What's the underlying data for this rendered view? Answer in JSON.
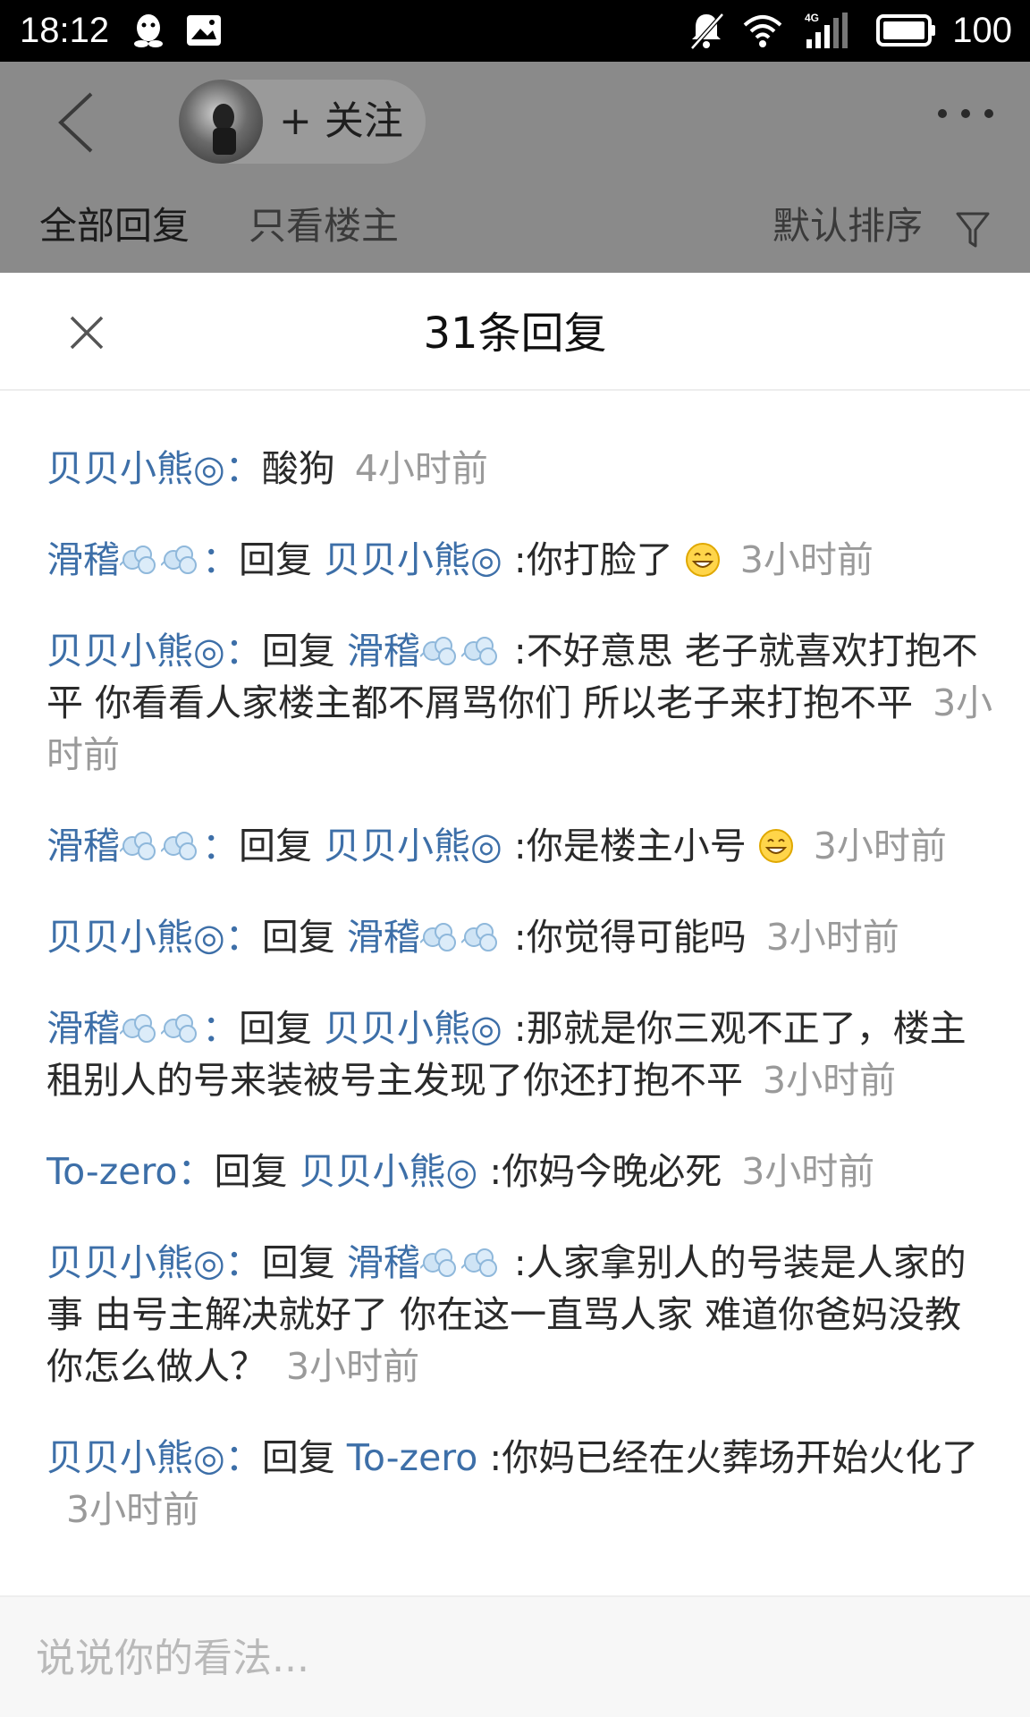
{
  "status_bar": {
    "time": "18:12",
    "battery": "100",
    "icons": [
      "qq-icon",
      "image-message-icon",
      "mute-icon",
      "wifi-icon",
      "signal-4g-icon",
      "battery-icon"
    ]
  },
  "header": {
    "follow_label": "+ 关注",
    "tabs": [
      {
        "label": "全部回复"
      },
      {
        "label": "只看楼主"
      }
    ],
    "sort_label": "默认排序"
  },
  "sheet": {
    "title": "31条回复"
  },
  "replies": [
    {
      "user": "贝贝小熊◎",
      "text": "酸狗",
      "time": "4小时前"
    },
    {
      "user": "滑稽",
      "reply_word": "回复",
      "target": "贝贝小熊◎",
      "text": ":你打脸了",
      "emoji": "grin-emoji",
      "time": "3小时前"
    },
    {
      "user": "贝贝小熊◎",
      "reply_word": "回复",
      "target": "滑稽",
      "text": ":不好意思 老子就喜欢打抱不平 你看看人家楼主都不屑骂你们 所以老子来打抱不平",
      "time": "3小时前"
    },
    {
      "user": "滑稽",
      "reply_word": "回复",
      "target": "贝贝小熊◎",
      "text": ":你是楼主小号",
      "emoji": "grin-emoji",
      "time": "3小时前"
    },
    {
      "user": "贝贝小熊◎",
      "reply_word": "回复",
      "target": "滑稽",
      "text": ":你觉得可能吗",
      "time": "3小时前"
    },
    {
      "user": "滑稽",
      "reply_word": "回复",
      "target": "贝贝小熊◎",
      "text": ":那就是你三观不正了，楼主租别人的号来装被号主发现了你还打抱不平",
      "time": "3小时前"
    },
    {
      "user": "To-zero",
      "reply_word": "回复",
      "target": "贝贝小熊◎",
      "text": ":你妈今晚必死",
      "time": "3小时前"
    },
    {
      "user": "贝贝小熊◎",
      "reply_word": "回复",
      "target": "滑稽",
      "text": ":人家拿别人的号装是人家的事 由号主解决就好了 你在这一直骂人家 难道你爸妈没教你怎么做人？",
      "time": "3小时前"
    },
    {
      "user": "贝贝小熊◎",
      "reply_word": "回复",
      "target": "To-zero",
      "text": ":你妈已经在火葬场开始火化了",
      "time": "3小时前"
    }
  ],
  "comment_box": {
    "placeholder": "说说你的看法..."
  },
  "colors": {
    "username": "#3d6fa8",
    "timestamp": "#9a9a9a",
    "dim_overlay": "#8a8a8a"
  }
}
